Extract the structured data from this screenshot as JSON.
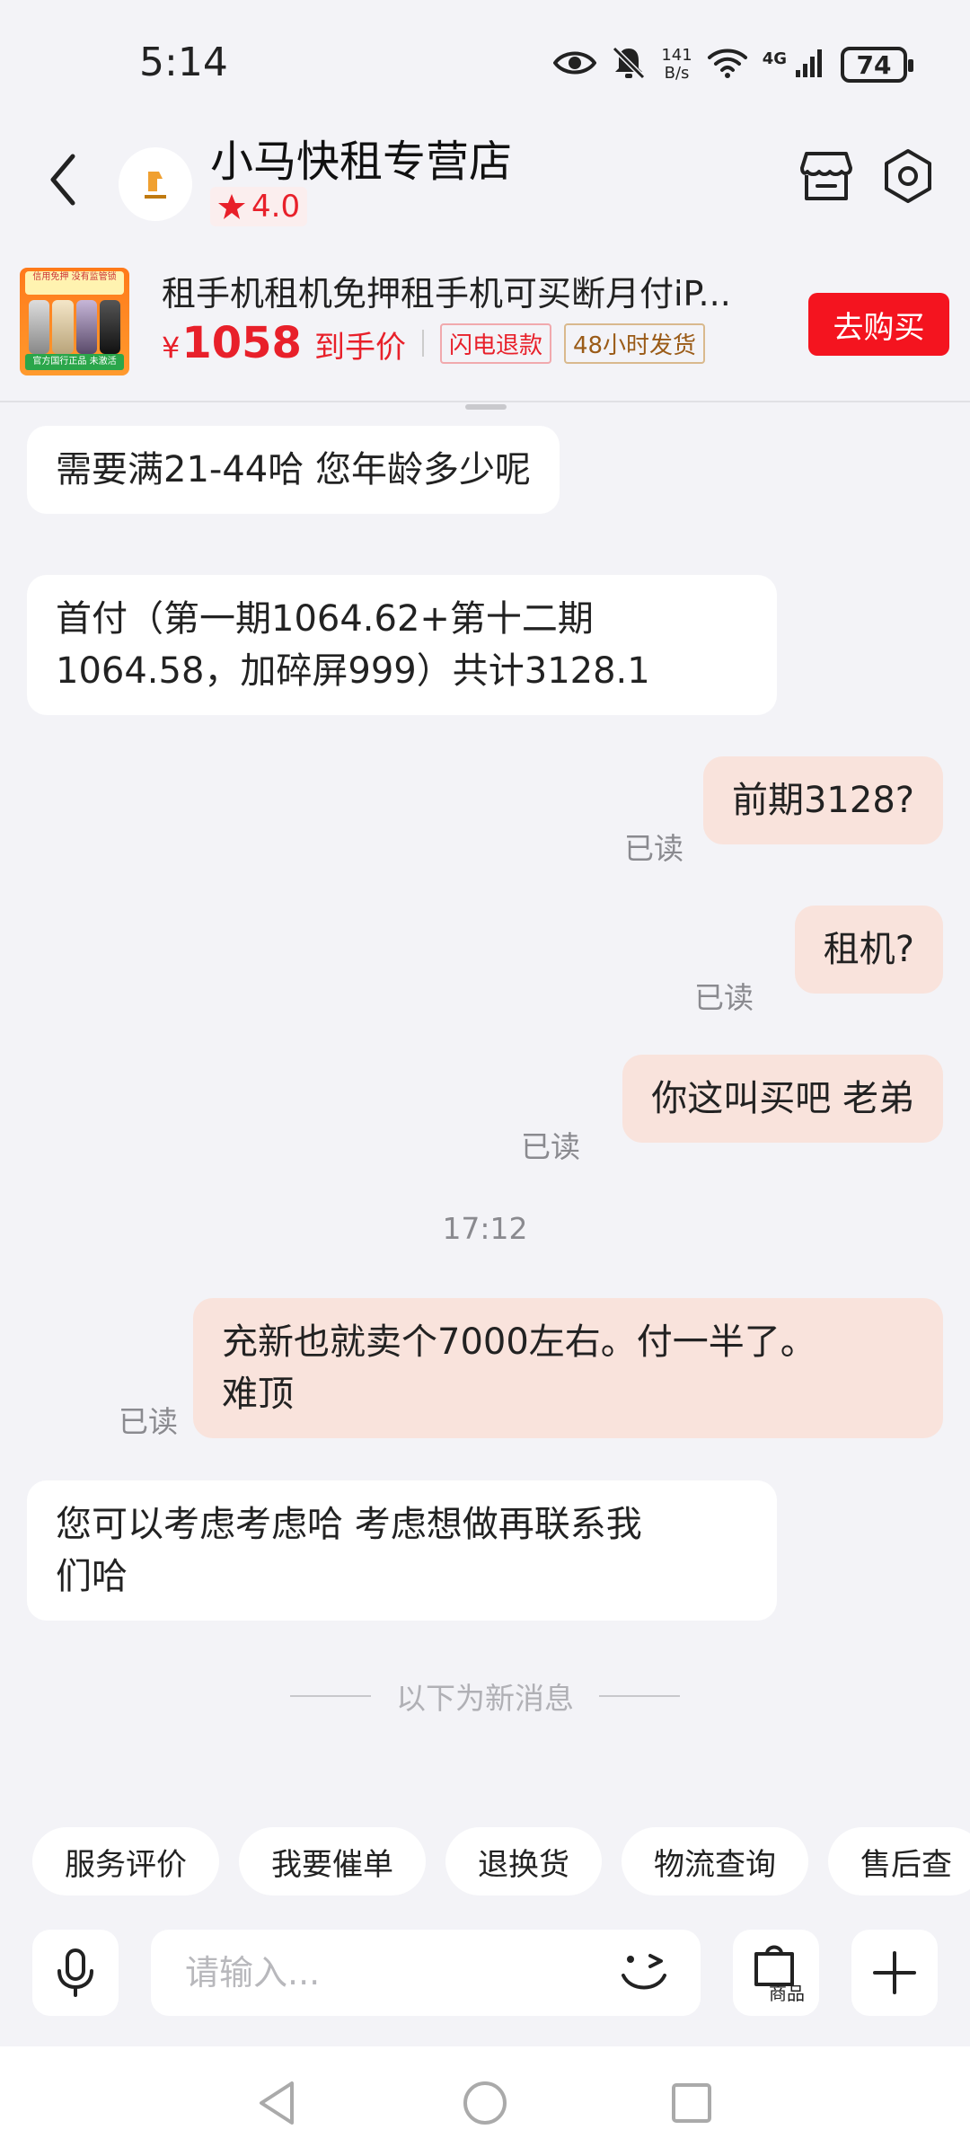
{
  "status_bar": {
    "time": "5:14",
    "net_speed_value": "141",
    "net_speed_unit": "B/s",
    "network": "4G",
    "battery": "74"
  },
  "header": {
    "shop_name": "小马快租专营店",
    "rating": "4.0"
  },
  "product": {
    "title": "租手机租机免押租手机可买断月付iP...",
    "price_symbol": "¥",
    "price": "1058",
    "price_note": "到手价",
    "tags": [
      "闪电退款",
      "48小时发货"
    ],
    "buy_label": "去购买",
    "thumb_top_text": "信用免押 没有监管锁",
    "thumb_bottom_text": "官方国行正品 未激活"
  },
  "messages": [
    {
      "side": "in",
      "text": "需要满21-44哈  您年龄多少呢"
    },
    {
      "side": "in",
      "line1": "首付（第一期1064.62+第十二期",
      "line2": "1064.58，加碎屏999）共计3128.1"
    },
    {
      "side": "out",
      "text": "前期3128?",
      "read": "已读"
    },
    {
      "side": "out",
      "text": "租机?",
      "read": "已读"
    },
    {
      "side": "out",
      "text": "你这叫买吧 老弟",
      "read": "已读"
    },
    {
      "side": "out",
      "line1": "充新也就卖个7000左右。付一半了。",
      "line2": "难顶",
      "read": "已读"
    },
    {
      "side": "in",
      "line1": "您可以考虑考虑哈  考虑想做再联系我",
      "line2": "们哈"
    }
  ],
  "timestamp": "17:12",
  "new_messages_divider": "以下为新消息",
  "quick_actions": [
    "服务评价",
    "我要催单",
    "退换货",
    "物流查询",
    "售后查"
  ],
  "input": {
    "placeholder": "请输入...",
    "goods_label": "商品"
  },
  "colors": {
    "accent_red": "#f4141f",
    "outgoing_bubble": "#f9e3dc",
    "incoming_bubble": "#ffffff",
    "background": "#f3f3f7"
  },
  "icons": [
    "back-icon",
    "eye-icon",
    "mute-icon",
    "wifi-icon",
    "signal-icon",
    "battery-icon",
    "star-icon",
    "store-icon",
    "settings-icon",
    "mic-icon",
    "emoji-icon",
    "shopping-bag-icon",
    "plus-icon",
    "nav-back-icon",
    "nav-home-icon",
    "nav-recent-icon"
  ]
}
